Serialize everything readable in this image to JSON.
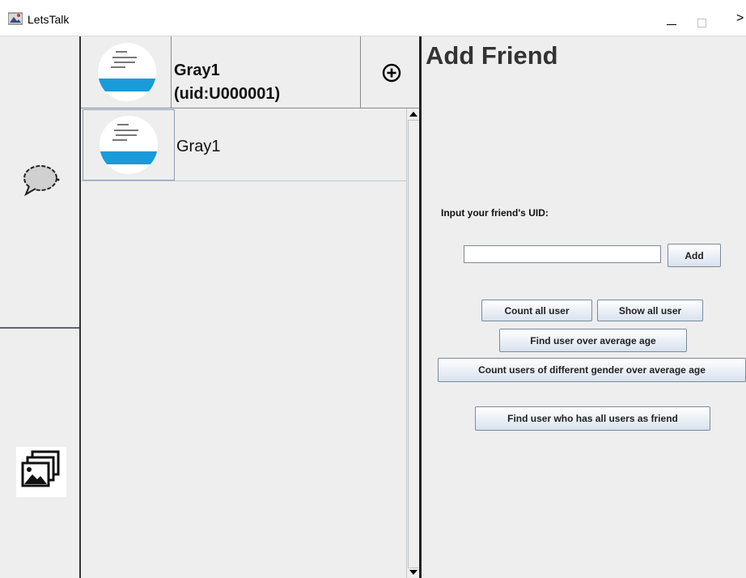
{
  "window": {
    "title": "LetsTalk",
    "minimize_label": "—",
    "maximize_label": "□",
    "close_label": "✕"
  },
  "sidebar": {
    "items": [
      {
        "name": "chat",
        "icon": "chat-bubble-icon"
      },
      {
        "name": "photos",
        "icon": "photo-gallery-icon"
      }
    ]
  },
  "profile": {
    "name_line1": "Gray1",
    "name_line2": "(uid:U000001)",
    "avatar_icon": "avatar-icon",
    "add_icon": "circle-plus-icon"
  },
  "friends": [
    {
      "name": "Gray1"
    }
  ],
  "add_friend": {
    "title": "Add Friend",
    "uid_label": "Input your friend's UID:",
    "uid_value": "",
    "add_button": "Add",
    "count_all_button": "Count all user",
    "show_all_button": "Show all user",
    "over_avg_button": "Find user over average age",
    "gender_over_avg_button": "Count users of different gender over average age",
    "all_friends_button": "Find user who has all users as friend"
  },
  "colors": {
    "background": "#eeeeee",
    "avatar_band": "#1a9bd9",
    "button_border": "#7a8a9c"
  }
}
